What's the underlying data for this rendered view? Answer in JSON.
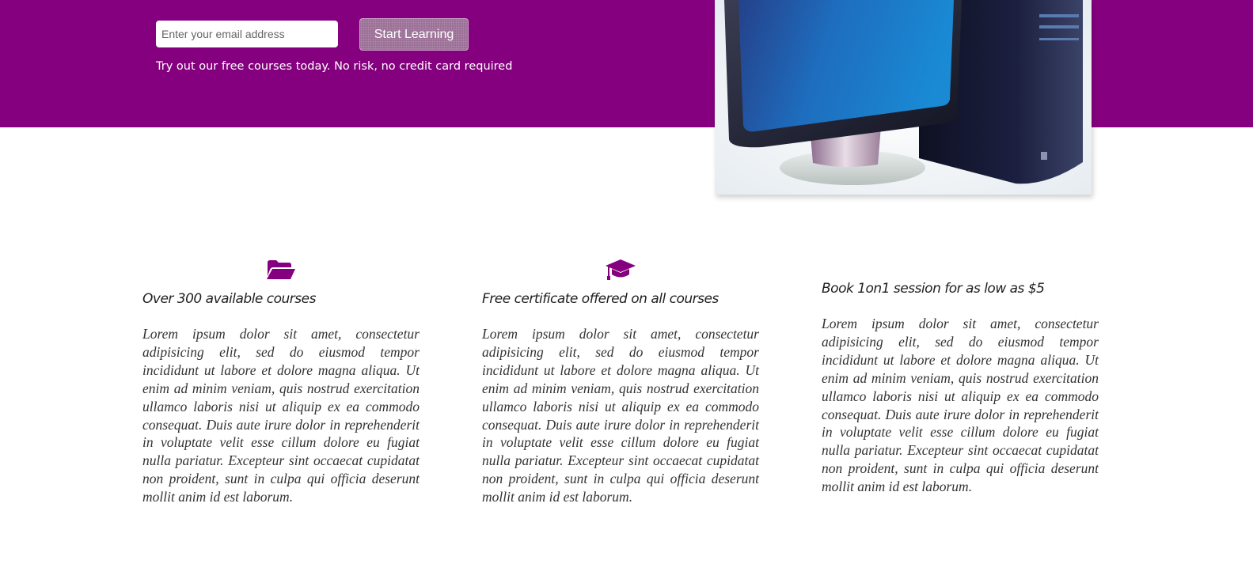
{
  "hero": {
    "email_placeholder": "Enter your email address",
    "start_button_label": "Start Learning",
    "tagline": "Try out our free courses today. No risk, no credit card required",
    "background_color": "#85007e"
  },
  "features": [
    {
      "icon": "folder-open-icon",
      "title": "Over 300 available courses",
      "text": "Lorem ipsum dolor sit amet, consectetur adipisicing elit, sed do eiusmod tempor incididunt ut labore et dolore magna aliqua. Ut enim ad minim veniam, quis nostrud exercitation ullamco laboris nisi ut aliquip ex ea commodo consequat. Duis aute irure dolor in reprehenderit in voluptate velit esse cillum dolore eu fugiat nulla pariatur. Excepteur sint occaecat cupidatat non proident, sunt in culpa qui officia deserunt mollit anim id est laborum."
    },
    {
      "icon": "graduation-cap-icon",
      "title": "Free certificate offered on all courses",
      "text": "Lorem ipsum dolor sit amet, consectetur adipisicing elit, sed do eiusmod tempor incididunt ut labore et dolore magna aliqua. Ut enim ad minim veniam, quis nostrud exercitation ullamco laboris nisi ut aliquip ex ea commodo consequat. Duis aute irure dolor in reprehenderit in voluptate velit esse cillum dolore eu fugiat nulla pariatur. Excepteur sint occaecat cupidatat non proident, sunt in culpa qui officia deserunt mollit anim id est laborum."
    },
    {
      "title": "Book 1on1 session for as low as $5",
      "text": "Lorem ipsum dolor sit amet, consectetur adipisicing elit, sed do eiusmod tempor incididunt ut labore et dolore magna aliqua. Ut enim ad minim veniam, quis nostrud exercitation ullamco laboris nisi ut aliquip ex ea commodo consequat. Duis aute irure dolor in reprehenderit in voluptate velit esse cillum dolore eu fugiat nulla pariatur. Excepteur sint occaecat cupidatat non proident, sunt in culpa qui officia deserunt mollit anim id est laborum."
    }
  ],
  "colors": {
    "accent": "#85007e",
    "heading_text": "#1f1f1f",
    "body_text": "#333333"
  }
}
